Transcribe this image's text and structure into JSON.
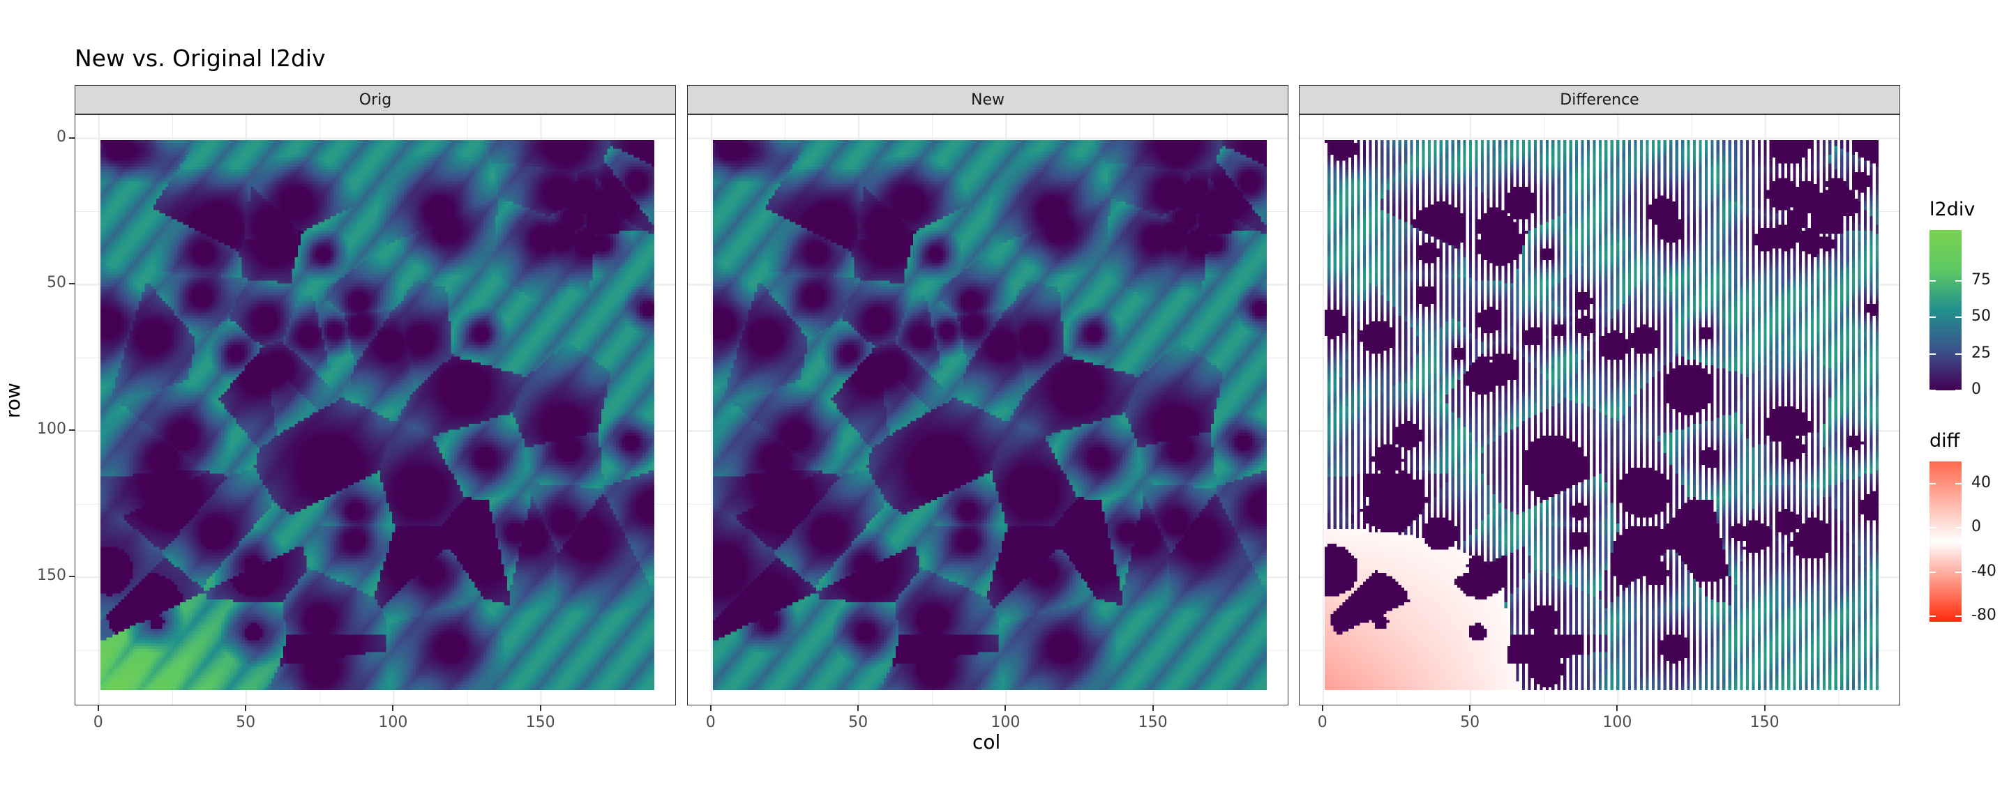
{
  "chart_data": {
    "type": "heatmap",
    "title": "New vs. Original l2div",
    "xlabel": "col",
    "ylabel": "row",
    "xlim": [
      0,
      188
    ],
    "ylim": [
      188,
      0
    ],
    "x_ticks": [
      "0",
      "50",
      "100",
      "150"
    ],
    "y_ticks": [
      "0",
      "50",
      "100",
      "150"
    ],
    "facets": [
      {
        "label": "Orig",
        "fill": "l2div"
      },
      {
        "label": "New",
        "fill": "l2div"
      },
      {
        "label": "Difference",
        "fill": "diff"
      }
    ],
    "legends": [
      {
        "title": "l2div",
        "range": [
          0,
          110
        ],
        "breaks": [
          "75",
          "50",
          "25",
          "0"
        ],
        "break_values": [
          75,
          50,
          25,
          0
        ],
        "colors": [
          "#440154",
          "#3b528b",
          "#21908d",
          "#5dc863",
          "#7ad151"
        ]
      },
      {
        "title": "diff",
        "range": [
          -85,
          60
        ],
        "breaks": [
          "40",
          "0",
          "-40",
          "-80"
        ],
        "break_values": [
          40,
          0,
          -40,
          -80
        ],
        "colors": [
          "#ff2a0a",
          "#ffffff",
          "#ff6a4d"
        ]
      }
    ],
    "grid": true,
    "legend_position": "right"
  }
}
